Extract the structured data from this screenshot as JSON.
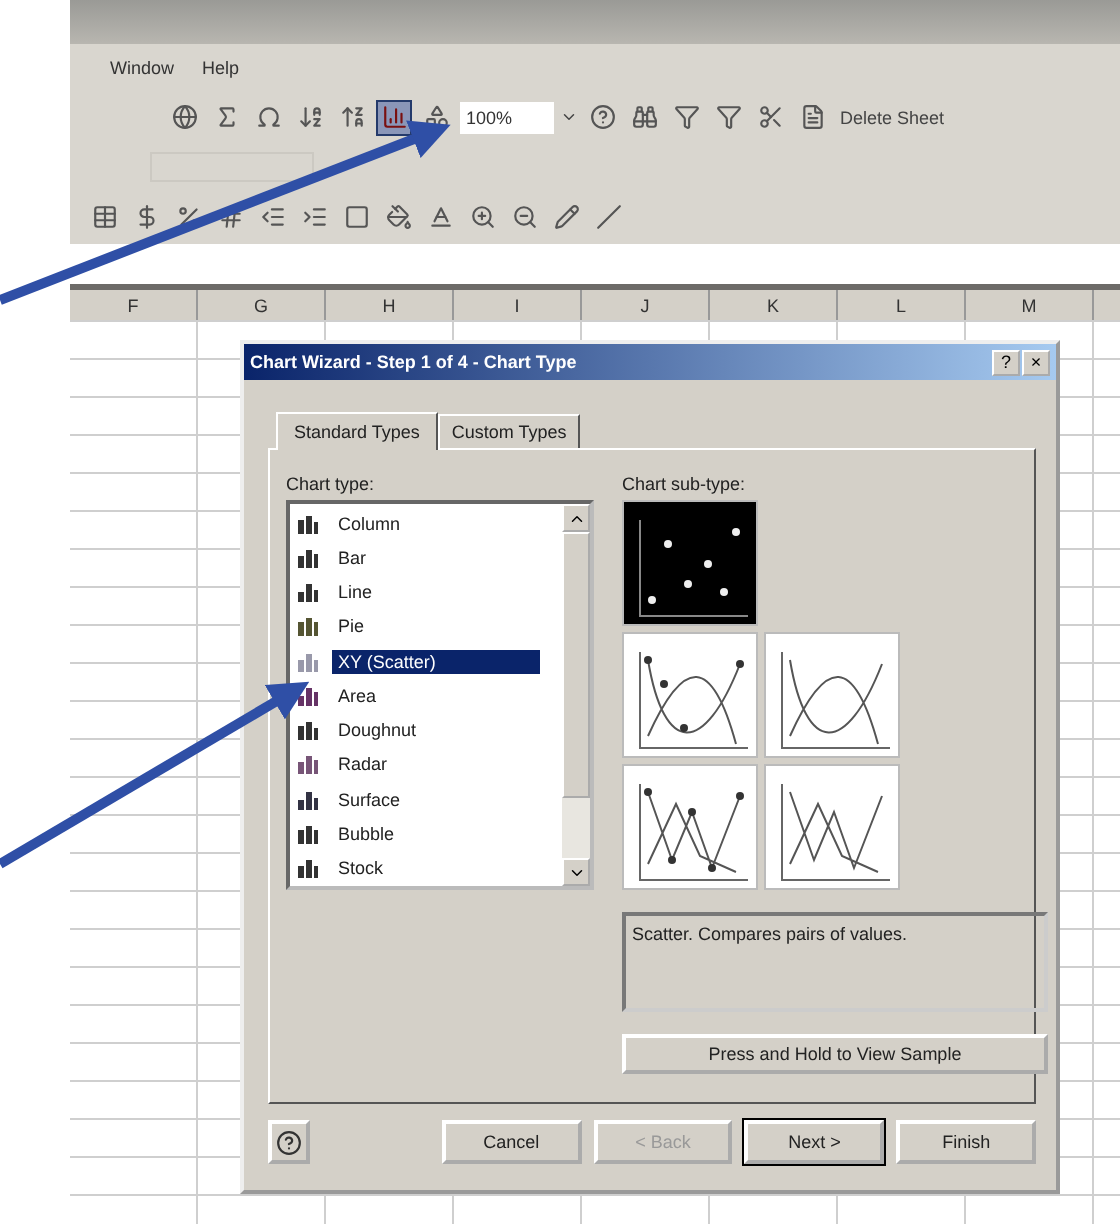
{
  "menu": [
    "Window",
    "Help"
  ],
  "standard_toolbar": {
    "zoom": "100%",
    "delete_sheet": "Delete Sheet",
    "chart_wizard_highlighted": true
  },
  "columns": [
    "F",
    "G",
    "H",
    "I",
    "J",
    "K",
    "L",
    "M"
  ],
  "dialog": {
    "title": "Chart Wizard - Step 1 of 4 - Chart Type",
    "title_buttons": [
      "?",
      "×"
    ],
    "tabs": [
      {
        "label": "Standard Types",
        "selected": true
      },
      {
        "label": "Custom Types",
        "selected": false
      }
    ],
    "chart_type_label": "Chart type:",
    "chart_types": [
      {
        "label": "Column",
        "selected": false
      },
      {
        "label": "Bar",
        "selected": false
      },
      {
        "label": "Line",
        "selected": false
      },
      {
        "label": "Pie",
        "selected": false
      },
      {
        "label": "XY (Scatter)",
        "selected": true
      },
      {
        "label": "Area",
        "selected": false
      },
      {
        "label": "Doughnut",
        "selected": false
      },
      {
        "label": "Radar",
        "selected": false
      },
      {
        "label": "Surface",
        "selected": false
      },
      {
        "label": "Bubble",
        "selected": false
      },
      {
        "label": "Stock",
        "selected": false
      }
    ],
    "sub_type_label": "Chart sub-type:",
    "sub_types": [
      {
        "kind": "markers",
        "selected": true
      },
      {
        "kind": "smooth-markers",
        "selected": false
      },
      {
        "kind": "smooth",
        "selected": false
      },
      {
        "kind": "lines-markers",
        "selected": false
      },
      {
        "kind": "lines",
        "selected": false
      }
    ],
    "description": "Scatter. Compares pairs of values.",
    "sample_button": "Press and Hold to View Sample",
    "buttons": [
      {
        "label": "Cancel",
        "disabled": false,
        "default": false
      },
      {
        "label": "< Back",
        "disabled": true,
        "default": false
      },
      {
        "label": "Next >",
        "disabled": false,
        "default": true
      },
      {
        "label": "Finish",
        "disabled": false,
        "default": false
      }
    ]
  }
}
